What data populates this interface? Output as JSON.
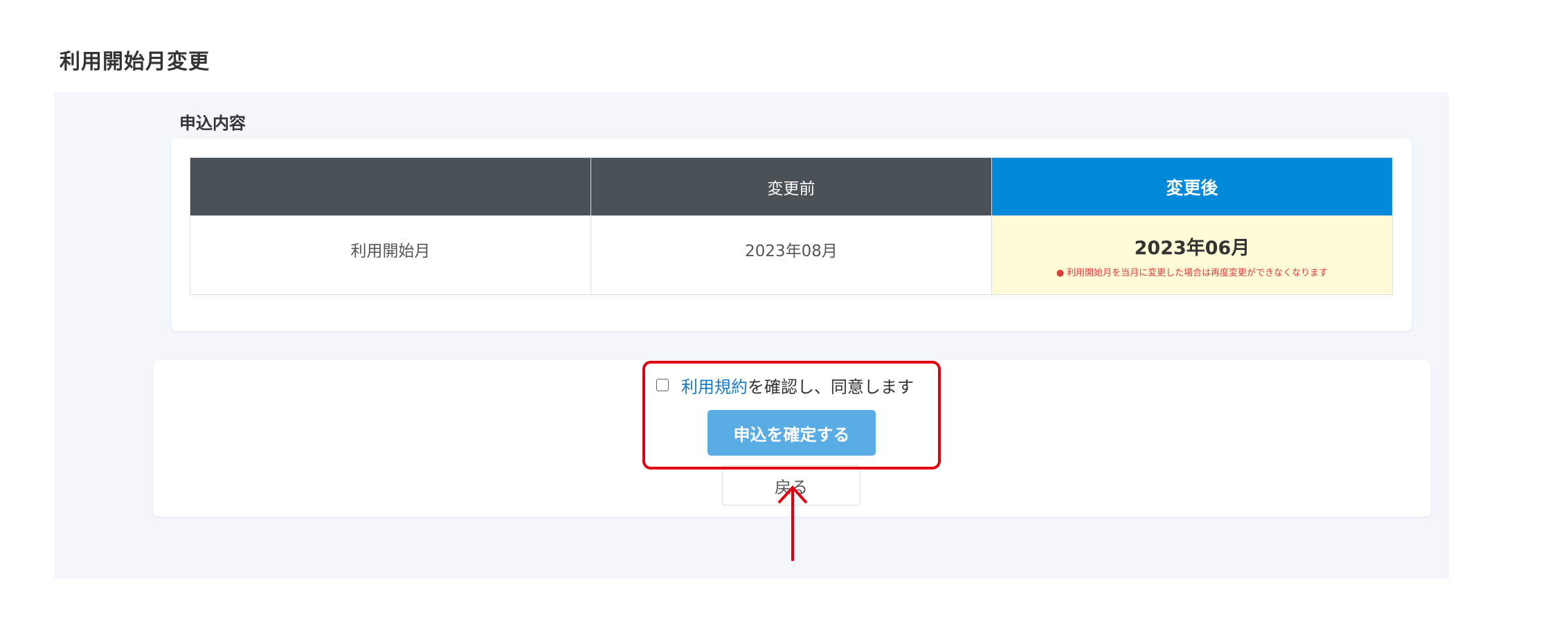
{
  "page": {
    "title": "利用開始月変更"
  },
  "application": {
    "section_title": "申込内容",
    "table": {
      "headers": [
        "",
        "変更前",
        "変更後"
      ],
      "row": {
        "label": "利用開始月",
        "before": "2023年08月",
        "after": "2023年06月",
        "note": "利用開始月を当月に変更した場合は再度変更ができなくなります"
      }
    }
  },
  "agreement": {
    "terms_link": "利用規約",
    "agree_text": "を確認し、同意します",
    "checked": false
  },
  "buttons": {
    "confirm_label": "申込を確定する",
    "back_label": "戻る"
  },
  "colors": {
    "header_dark": "#4a5157",
    "header_accent": "#0088d9",
    "after_cell_bg": "#fffbd9",
    "confirm_button": "#5aade4",
    "highlight": "#e00012",
    "note_text": "#e03b3b",
    "link": "#1a7bcc"
  },
  "icons": {
    "checkbox": "checkbox-unchecked-icon",
    "annotation": "arrow-up-icon",
    "note": "bullet-icon"
  }
}
